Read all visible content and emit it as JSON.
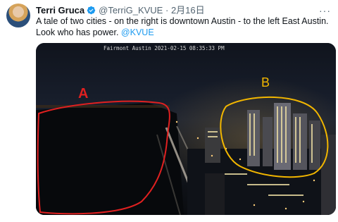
{
  "tweet": {
    "author_name": "Terri Gruca",
    "handle": "@TerriG_KVUE",
    "separator": "·",
    "date": "2月16日",
    "more_icon": "more-dots-icon",
    "text_main": "A tale of two cities - on the right is downtown Austin - to the left East Austin. Look who has power. ",
    "mention": "@KVUE"
  },
  "media": {
    "camera_label": "Fairmont Austin  2021-02-15  08:35:33 PM",
    "annotation_a": "A",
    "annotation_b": "B",
    "colors": {
      "annotation_a": "#e02020",
      "annotation_b": "#f2b600"
    }
  }
}
